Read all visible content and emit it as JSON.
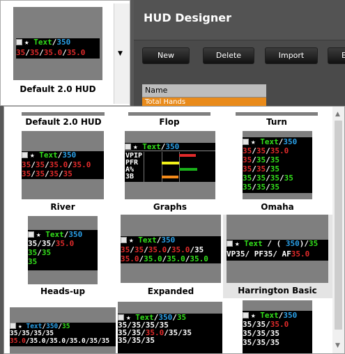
{
  "window": {
    "title": "HUD Designer"
  },
  "toolbar": {
    "new_label": "New",
    "delete_label": "Delete",
    "import_label": "Import",
    "export_partial_label": "E"
  },
  "list": {
    "header": "Name",
    "selected_row": "Total Hands"
  },
  "combo": {
    "selected": "Default 2.0 HUD"
  },
  "colors": {
    "green": "#33e01b",
    "blue": "#2aa0e8",
    "red": "#e02a2a",
    "accent_orange": "#e98b1b",
    "highlight": "#e4e4e4"
  },
  "icons": {
    "hud_icon": "player-icon",
    "star": "star-icon"
  },
  "tokens": {
    "star": "★",
    "text": "Text",
    "slash": "/",
    "n350": "350",
    "n35": "35",
    "n350f": "35.0",
    "lp": "(",
    "rp": ")",
    "vp": "VP",
    "pf": "PF",
    "af": "AF"
  },
  "graph_labels": [
    "VPIP",
    "PFR",
    "A%",
    "3B"
  ],
  "items": {
    "default": "Default 2.0 HUD",
    "flop": "Flop",
    "turn": "Turn",
    "river": "River",
    "graphs": "Graphs",
    "omaha": "Omaha",
    "headsup": "Heads-up",
    "expanded": "Expanded",
    "harrington": "Harrington Basic"
  }
}
